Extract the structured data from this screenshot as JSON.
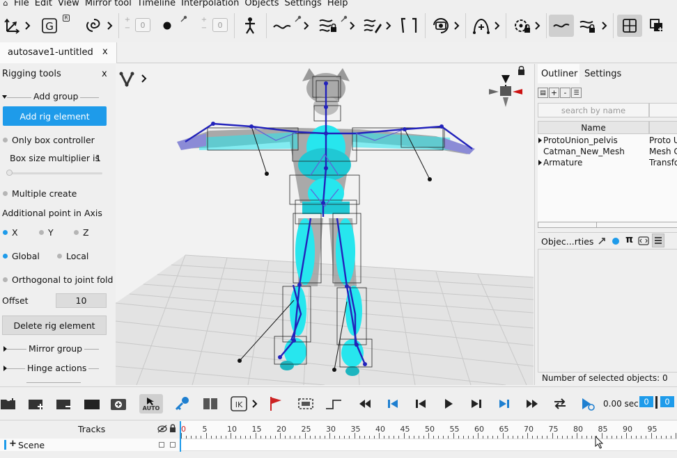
{
  "menu": {
    "items": [
      "File",
      "Edit",
      "View",
      "Mirror tool",
      "Timeline",
      "Interpolation",
      "Objects",
      "Settings",
      "Help"
    ]
  },
  "toolbar": {
    "counter_a": "0",
    "counter_b": "0",
    "r_badge": "R",
    "icons": [
      "transform-axes-icon",
      "g-letter-icon",
      "lasso-icon",
      "plus-minus-counter-icon",
      "dot-brush-icon",
      "stickman-icon",
      "curve-icon",
      "lock-curves-icon",
      "pen-curves-icon",
      "bracket-icon",
      "camera-icon",
      "bone-add-icon",
      "target-lock-icon",
      "wave-icon",
      "lock-wave-icon",
      "grid-icon",
      "layers-icon"
    ]
  },
  "tab": {
    "title": "autosave1-untitled",
    "close": "x"
  },
  "rigging": {
    "title": "Rigging tools",
    "close": "x",
    "add_group": "Add group",
    "add_rig_element": "Add rig element",
    "only_box_controller": "Only box controller",
    "box_size_label": "Box size multiplier is",
    "box_size_value": "1",
    "box_size_slider": 0.0,
    "multiple_create": "Multiple create",
    "additional_point": "Additional point in Axis",
    "axis_options": [
      "X",
      "Y",
      "Z"
    ],
    "axis_selected": "X",
    "space_options": [
      "Global",
      "Local"
    ],
    "space_selected": "Global",
    "orthogonal": "Orthogonal to joint fold",
    "offset_label": "Offset",
    "offset_value": "10",
    "delete_rig_element": "Delete rig element",
    "mirror_group": "Mirror group",
    "hinge_actions": "Hinge actions"
  },
  "viewport": {
    "mode_icon": "v-logo-icon",
    "colors": {
      "mesh": "#27e6ee",
      "bone": "#2222bb",
      "floor": "#e2e2e2",
      "grid": "#c8c8c8"
    }
  },
  "outliner": {
    "tabs": [
      "Outliner",
      "Settings"
    ],
    "active_tab": "Outliner",
    "toolbar_buttons": [
      "+",
      "-"
    ],
    "search_placeholder": "search by name",
    "columns": [
      "Name",
      ""
    ],
    "rows": [
      {
        "name": "ProtoUnion_pelvis",
        "type": "Proto U",
        "expandable": true
      },
      {
        "name": "Catman_New_Mesh",
        "type": "Mesh C",
        "expandable": false
      },
      {
        "name": "Armature",
        "type": "Transfo",
        "expandable": true
      }
    ],
    "properties_title": "Objec...rties",
    "selected_count": "Number of selected objects: 0"
  },
  "timeline": {
    "time": "0.00 sec",
    "frame_a": "0",
    "frame_b": "0",
    "auto_label": "AUTO",
    "tracks_label": "Tracks",
    "scene_label": "Scene",
    "ruler_marks": [
      "0",
      "5",
      "10",
      "15",
      "20",
      "25",
      "30",
      "35",
      "40",
      "45",
      "50",
      "55",
      "60",
      "65",
      "70",
      "75",
      "80",
      "85",
      "90",
      "95"
    ],
    "accent": "#1e9bea"
  }
}
